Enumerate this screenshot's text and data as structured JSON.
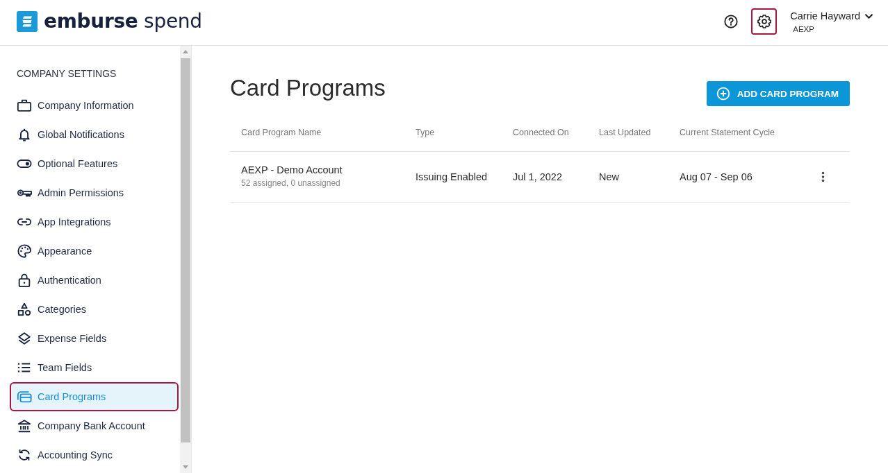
{
  "header": {
    "logo": "**emburse** spend",
    "actions": [
      {
        "kind": "help",
        "active": false
      },
      {
        "kind": "settings",
        "active": true
      }
    ],
    "user": {
      "name": "Carrie Hayward",
      "account": "AEXP",
      "expanded": false
    }
  },
  "sidebar": {
    "heading": "COMPANY SETTINGS",
    "items": [
      {
        "label": "Company Information",
        "selected": false
      },
      {
        "label": "Global Notifications",
        "selected": false
      },
      {
        "label": "Optional Features",
        "selected": false
      },
      {
        "label": "Admin Permissions",
        "selected": false
      },
      {
        "label": "App Integrations",
        "selected": false
      },
      {
        "label": "Appearance",
        "selected": false
      },
      {
        "label": "Authentication",
        "selected": false
      },
      {
        "label": "Categories",
        "selected": false
      },
      {
        "label": "Expense Fields",
        "selected": false
      },
      {
        "label": "Team Fields",
        "selected": false
      },
      {
        "label": "Card Programs",
        "selected": true
      },
      {
        "label": "Company Bank Account",
        "selected": false
      },
      {
        "label": "Accounting Sync",
        "selected": false
      }
    ]
  },
  "page": {
    "title": "Card Programs",
    "add_button": "ADD CARD PROGRAM"
  },
  "table": {
    "columns": [
      "Card Program Name",
      "Type",
      "Connected On",
      "Last Updated",
      "Current Statement Cycle"
    ],
    "rows": [
      {
        "name": "AEXP - Demo Account",
        "summary": "52 assigned, 0 unassigned",
        "type": "Issuing Enabled",
        "connected_on": "Jul 1, 2022",
        "last_updated": "New",
        "statement_cycle": "Aug 07 - Sep 06"
      }
    ]
  }
}
